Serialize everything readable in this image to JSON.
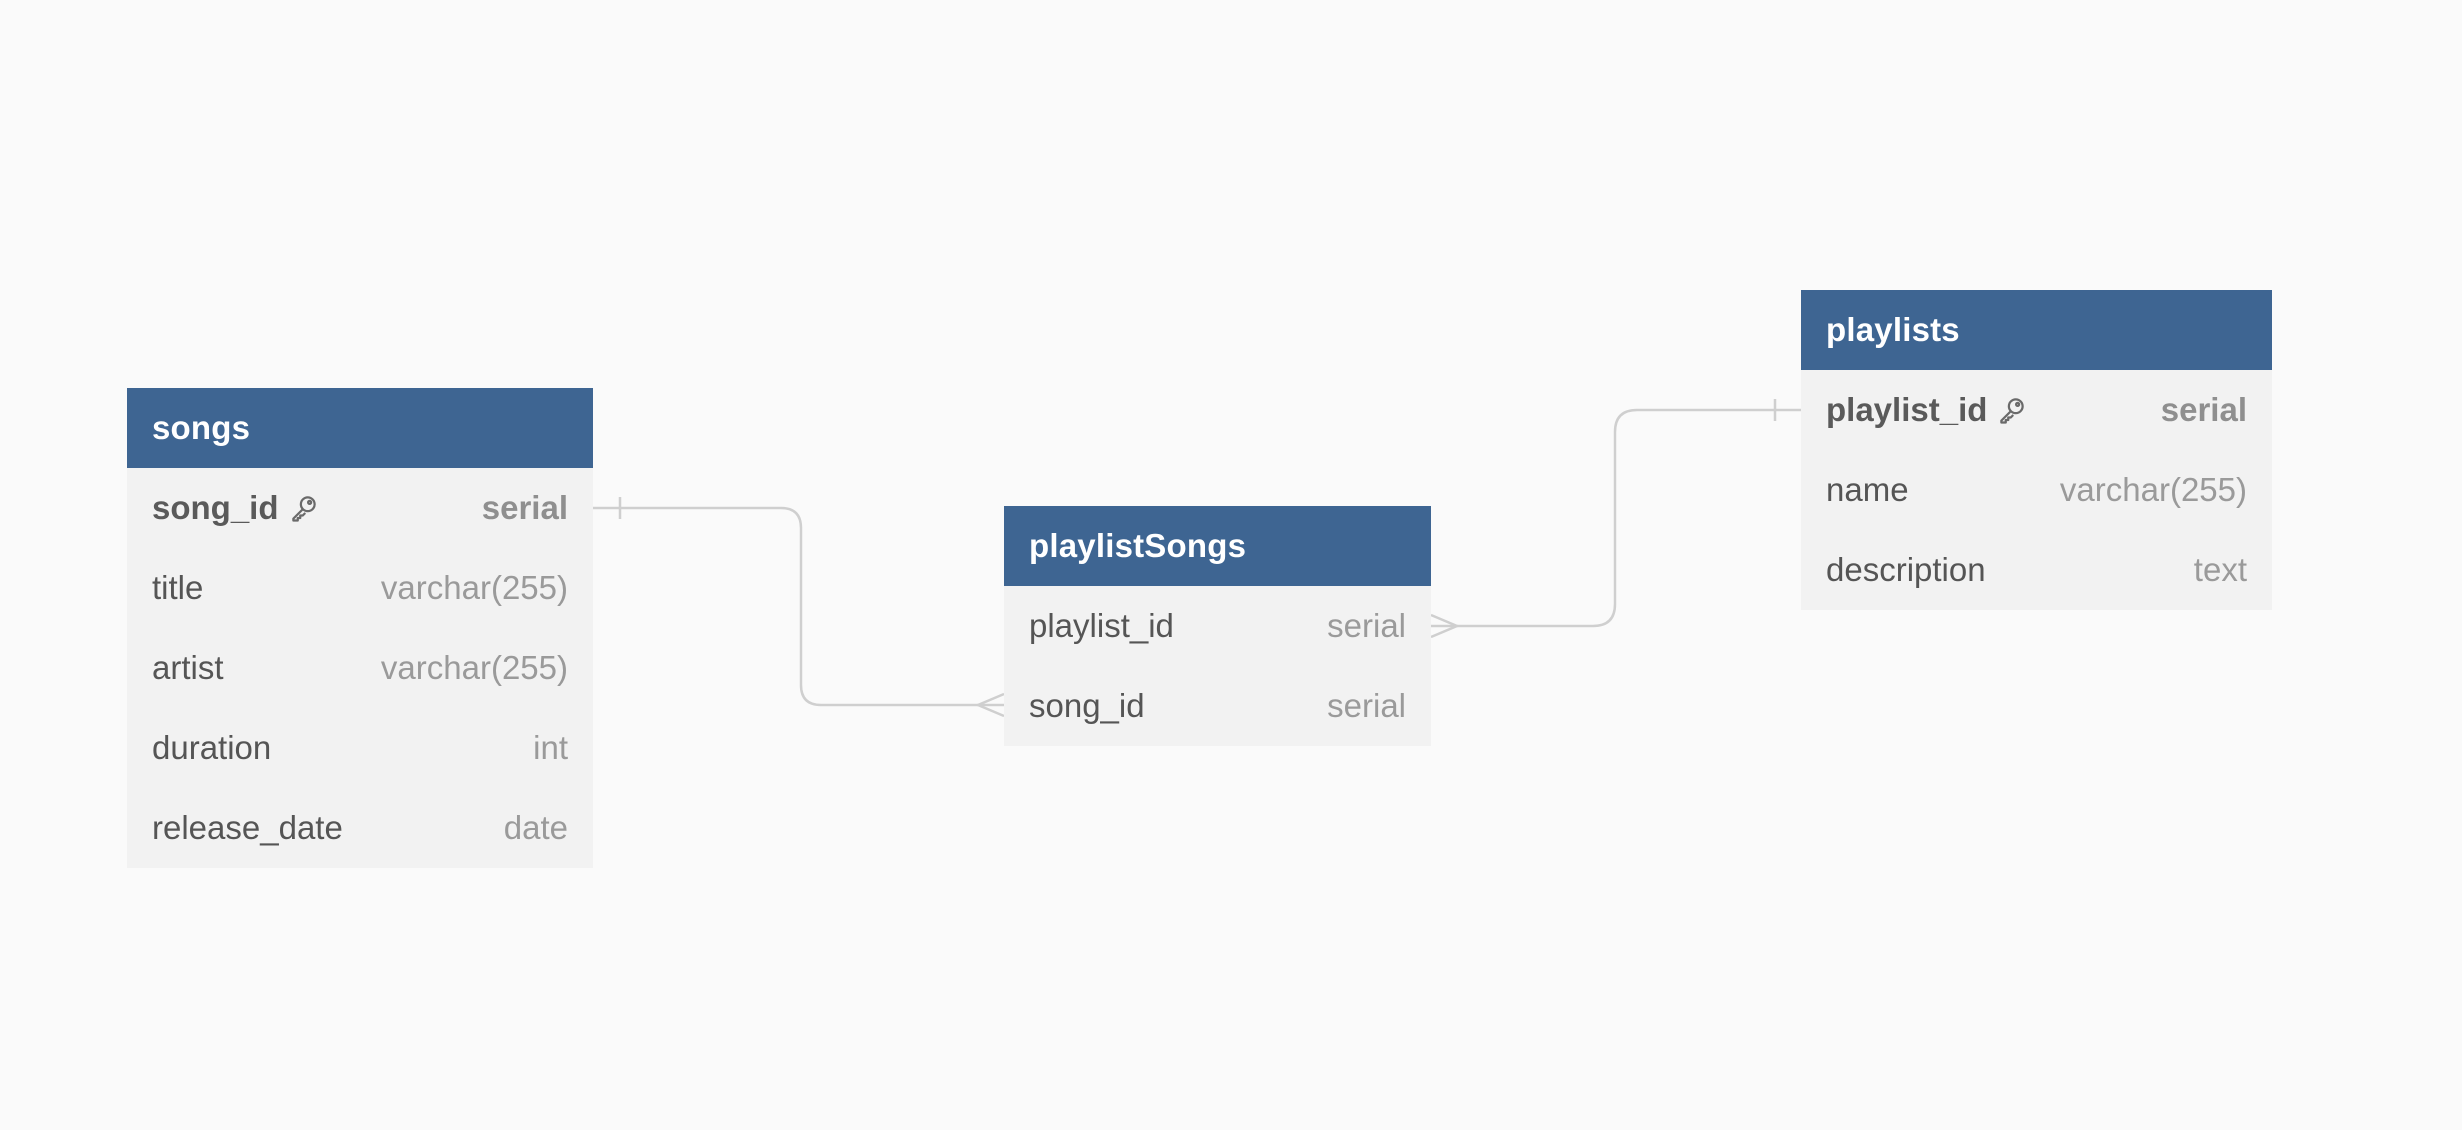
{
  "diagram": {
    "colors": {
      "header_bg": "#3e6592",
      "header_text": "#ffffff",
      "body_bg": "#f2f2f2",
      "field_name": "#555555",
      "field_type": "#9a9a9a",
      "connector": "#cfcfcf",
      "canvas": "#fafafa"
    },
    "tables": [
      {
        "name": "songs",
        "fields": [
          {
            "name": "song_id",
            "type": "serial",
            "primary_key": true,
            "icon": "key-icon"
          },
          {
            "name": "title",
            "type": "varchar(255)",
            "primary_key": false
          },
          {
            "name": "artist",
            "type": "varchar(255)",
            "primary_key": false
          },
          {
            "name": "duration",
            "type": "int",
            "primary_key": false
          },
          {
            "name": "release_date",
            "type": "date",
            "primary_key": false
          }
        ]
      },
      {
        "name": "playlistSongs",
        "fields": [
          {
            "name": "playlist_id",
            "type": "serial",
            "primary_key": false
          },
          {
            "name": "song_id",
            "type": "serial",
            "primary_key": false
          }
        ]
      },
      {
        "name": "playlists",
        "fields": [
          {
            "name": "playlist_id",
            "type": "serial",
            "primary_key": true,
            "icon": "key-icon"
          },
          {
            "name": "name",
            "type": "varchar(255)",
            "primary_key": false
          },
          {
            "name": "description",
            "type": "text",
            "primary_key": false
          }
        ]
      }
    ],
    "relationships": [
      {
        "from": "songs.song_id",
        "from_cardinality": "one",
        "to": "playlistSongs.song_id",
        "to_cardinality": "many"
      },
      {
        "from": "playlists.playlist_id",
        "from_cardinality": "one",
        "to": "playlistSongs.playlist_id",
        "to_cardinality": "many"
      }
    ]
  }
}
